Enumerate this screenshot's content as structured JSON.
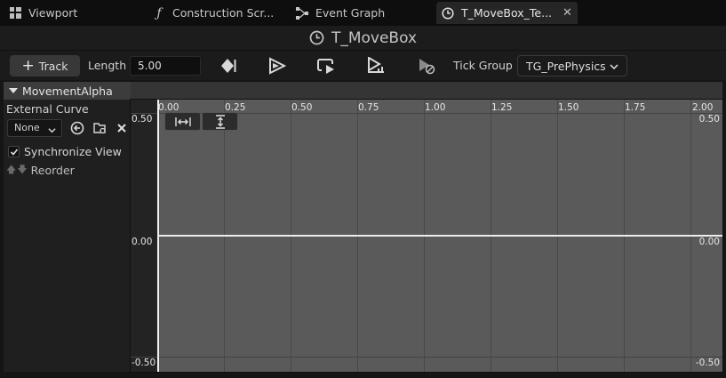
{
  "tabs": [
    {
      "label": "Viewport",
      "icon": "viewport-grid-icon"
    },
    {
      "label": "Construction Scr...",
      "icon": "function-icon"
    },
    {
      "label": "Event Graph",
      "icon": "graph-icon"
    },
    {
      "label": "T_MoveBox_Te...",
      "icon": "clock-icon",
      "active": true
    }
  ],
  "window": {
    "title": "T_MoveBox",
    "icon": "clock-icon"
  },
  "toolbar": {
    "add_track_label": "Track",
    "length_label": "Length",
    "length_value": "5.00",
    "tick_group_label": "Tick Group",
    "tick_group_value": "TG_PrePhysics",
    "icons": [
      "use-last-keyframe-icon",
      "autoplay-icon",
      "loop-icon",
      "replicated-icon",
      "ignore-time-dilation-icon"
    ]
  },
  "track": {
    "name": "MovementAlpha",
    "external_curve_label": "External Curve",
    "external_curve_value": "None",
    "synchronize_view_label": "Synchronize View",
    "synchronize_view_checked": true,
    "reorder_label": "Reorder"
  },
  "graph": {
    "x_ticks": [
      "0.00",
      "0.25",
      "0.50",
      "0.75",
      "1.00",
      "1.25",
      "1.50",
      "1.75",
      "2.00"
    ],
    "y_labels": {
      "top": "0.50",
      "mid": "0.00",
      "bottom": "-0.50"
    }
  },
  "colors": {
    "accent": "#e6e6e6",
    "graph_bg": "#5a5a5a",
    "panel_bg": "#1f1f1f"
  }
}
